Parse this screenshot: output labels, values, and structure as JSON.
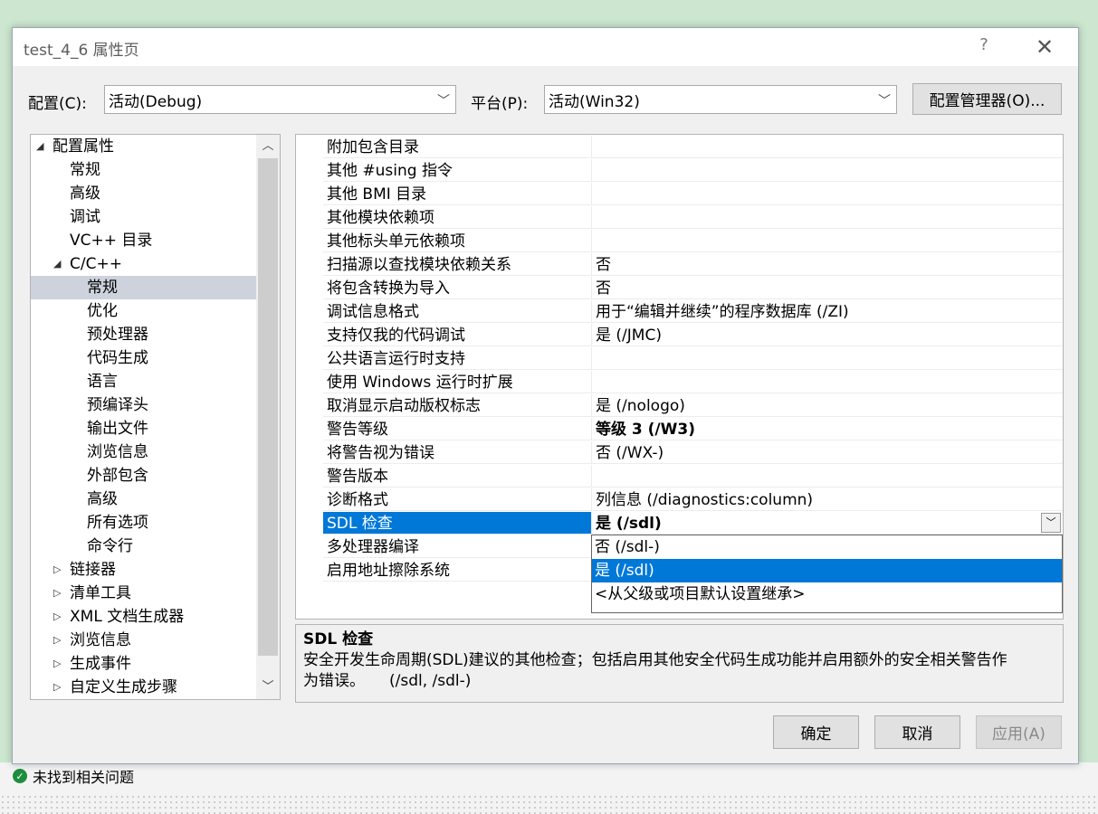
{
  "background": {
    "status_text": "未找到相关问题",
    "status_icon": "check-circle-icon"
  },
  "dialog": {
    "title": "test_4_6 属性页",
    "help": "?",
    "close": "✕",
    "config_label": "配置(C):",
    "config_value": "活动(Debug)",
    "platform_label": "平台(P):",
    "platform_value": "活动(Win32)",
    "config_manager": "配置管理器(O)...",
    "ok": "确定",
    "cancel": "取消",
    "apply": "应用(A)"
  },
  "tree": [
    {
      "label": "配置属性",
      "level": 0,
      "twisty": "◢"
    },
    {
      "label": "常规",
      "level": 1
    },
    {
      "label": "高级",
      "level": 1
    },
    {
      "label": "调试",
      "level": 1
    },
    {
      "label": "VC++ 目录",
      "level": 1
    },
    {
      "label": "C/C++",
      "level": 1,
      "twisty": "◢"
    },
    {
      "label": "常规",
      "level": 2,
      "selected": true
    },
    {
      "label": "优化",
      "level": 2
    },
    {
      "label": "预处理器",
      "level": 2
    },
    {
      "label": "代码生成",
      "level": 2
    },
    {
      "label": "语言",
      "level": 2
    },
    {
      "label": "预编译头",
      "level": 2
    },
    {
      "label": "输出文件",
      "level": 2
    },
    {
      "label": "浏览信息",
      "level": 2
    },
    {
      "label": "外部包含",
      "level": 2
    },
    {
      "label": "高级",
      "level": 2
    },
    {
      "label": "所有选项",
      "level": 2
    },
    {
      "label": "命令行",
      "level": 2
    },
    {
      "label": "链接器",
      "level": 1,
      "twisty": "▷"
    },
    {
      "label": "清单工具",
      "level": 1,
      "twisty": "▷"
    },
    {
      "label": "XML 文档生成器",
      "level": 1,
      "twisty": "▷"
    },
    {
      "label": "浏览信息",
      "level": 1,
      "twisty": "▷"
    },
    {
      "label": "生成事件",
      "level": 1,
      "twisty": "▷"
    },
    {
      "label": "自定义生成步骤",
      "level": 1,
      "twisty": "▷"
    }
  ],
  "properties": [
    {
      "name": "附加包含目录",
      "value": ""
    },
    {
      "name": "其他 #using 指令",
      "value": ""
    },
    {
      "name": "其他 BMI 目录",
      "value": ""
    },
    {
      "name": "其他模块依赖项",
      "value": ""
    },
    {
      "name": "其他标头单元依赖项",
      "value": ""
    },
    {
      "name": "扫描源以查找模块依赖关系",
      "value": "否"
    },
    {
      "name": "将包含转换为导入",
      "value": "否"
    },
    {
      "name": "调试信息格式",
      "value": "用于“编辑并继续”的程序数据库 (/ZI)"
    },
    {
      "name": "支持仅我的代码调试",
      "value": "是 (/JMC)"
    },
    {
      "name": "公共语言运行时支持",
      "value": ""
    },
    {
      "name": "使用 Windows 运行时扩展",
      "value": ""
    },
    {
      "name": "取消显示启动版权标志",
      "value": "是 (/nologo)"
    },
    {
      "name": "警告等级",
      "value": "等级 3 (/W3)",
      "bold": true
    },
    {
      "name": "将警告视为错误",
      "value": "否 (/WX-)"
    },
    {
      "name": "警告版本",
      "value": ""
    },
    {
      "name": "诊断格式",
      "value": "列信息 (/diagnostics:column)"
    },
    {
      "name": "SDL 检查",
      "value": "是 (/sdl)",
      "selected": true
    },
    {
      "name": "多处理器编译",
      "value": ""
    },
    {
      "name": "启用地址擦除系统",
      "value": ""
    }
  ],
  "dropdown_options": [
    {
      "label": "否 (/sdl-)"
    },
    {
      "label": "是 (/sdl)",
      "selected": true
    },
    {
      "label": "<从父级或项目默认设置继承>"
    }
  ],
  "description": {
    "title": "SDL 检查",
    "text_line1": "安全开发生命周期(SDL)建议的其他检查；包括启用其他安全代码生成功能并启用额外的安全相关警告作",
    "text_line2": "为错误。     (/sdl, /sdl-)"
  }
}
